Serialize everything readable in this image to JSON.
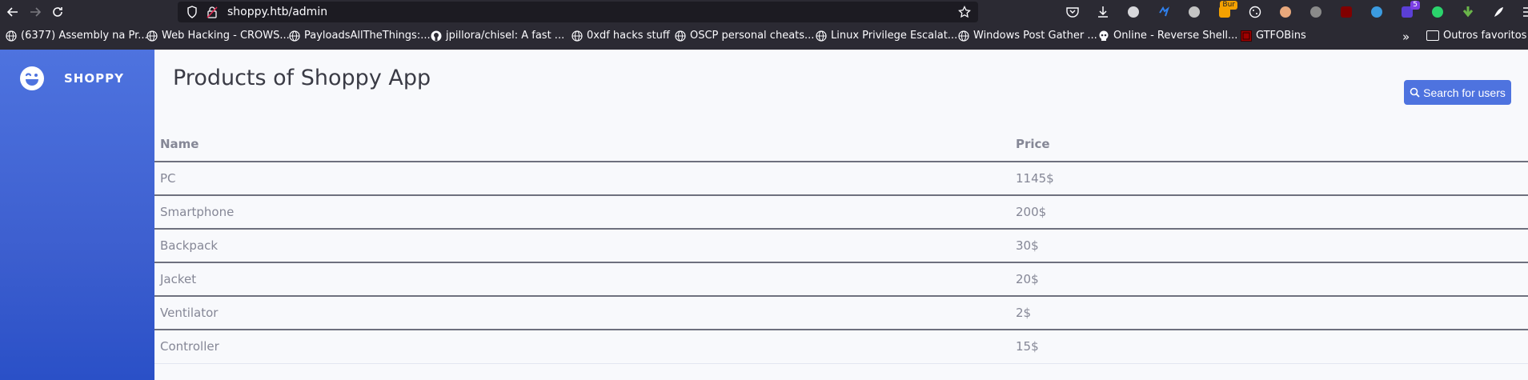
{
  "browser": {
    "url": "shoppy.htb/admin",
    "bookmarks": [
      {
        "label": "(6377) Assembly na Pr...",
        "icon": "globe-icon"
      },
      {
        "label": "Web Hacking - CROWS...",
        "icon": "globe-icon"
      },
      {
        "label": "PayloadsAllTheThings:...",
        "icon": "globe-icon"
      },
      {
        "label": "jpillora/chisel: A fast ...",
        "icon": "github-icon"
      },
      {
        "label": "0xdf hacks stuff",
        "icon": "globe-icon"
      },
      {
        "label": "OSCP personal cheats...",
        "icon": "globe-icon"
      },
      {
        "label": "Linux Privilege Escalat...",
        "icon": "globe-icon"
      },
      {
        "label": "Windows Post Gather ...",
        "icon": "globe-icon"
      },
      {
        "label": "Online - Reverse Shell...",
        "icon": "skull-icon"
      },
      {
        "label": "GTFOBins",
        "icon": "gtfobins-icon"
      }
    ],
    "other_bookmarks": "Outros favoritos",
    "extension_badges": {
      "burp": "Bur",
      "count": "5"
    }
  },
  "app": {
    "brand": "SHOPPY",
    "title": "Products of Shoppy App",
    "search_button": "Search for users",
    "table": {
      "headers": [
        "Name",
        "Price"
      ],
      "rows": [
        [
          "PC",
          "1145$"
        ],
        [
          "Smartphone",
          "200$"
        ],
        [
          "Backpack",
          "30$"
        ],
        [
          "Jacket",
          "20$"
        ],
        [
          "Ventilator",
          "2$"
        ],
        [
          "Controller",
          "15$"
        ]
      ]
    }
  },
  "colors": {
    "sidebar": "#4e73df",
    "primary_button": "#4e73df",
    "page_bg": "#f8f9fc",
    "title_text": "#3a3b45",
    "table_text": "#858796"
  }
}
